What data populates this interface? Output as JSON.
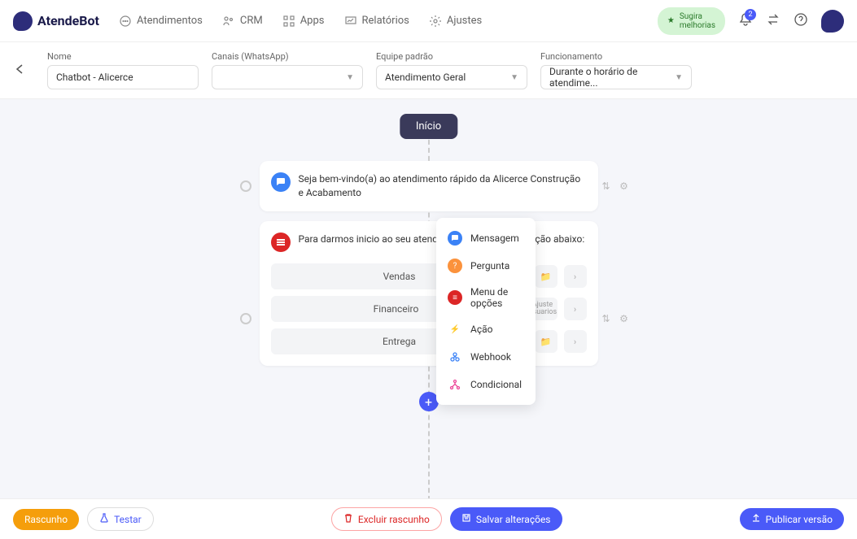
{
  "brand": "AtendeBot",
  "nav": {
    "atendimentos": "Atendimentos",
    "crm": "CRM",
    "apps": "Apps",
    "relatorios": "Relatórios",
    "ajustes": "Ajustes"
  },
  "header": {
    "suggest_line1": "Sugira",
    "suggest_line2": "melhorias",
    "notif_count": "2"
  },
  "config": {
    "nome_label": "Nome",
    "nome_value": "Chatbot - Alicerce",
    "canais_label": "Canais (WhatsApp)",
    "canais_value": "",
    "equipe_label": "Equipe padrão",
    "equipe_value": "Atendimento Geral",
    "func_label": "Funcionamento",
    "func_value": "Durante o horário de atendime..."
  },
  "flow": {
    "start": "Início",
    "msg1": "Seja bem-vindo(a) ao atendimento rápido da Alicerce Construção e Acabamento",
    "msg2": "Para darmos inicio ao seu atendimento, selecione a opção abaixo:",
    "options": [
      "Vendas",
      "Financeiro",
      "Entrega"
    ],
    "opt_tip1": "Ajuste",
    "opt_tip2": "Usuarios"
  },
  "popover": {
    "mensagem": "Mensagem",
    "pergunta": "Pergunta",
    "menu": "Menu de opções",
    "acao": "Ação",
    "webhook": "Webhook",
    "condicional": "Condicional"
  },
  "footer": {
    "rascunho": "Rascunho",
    "testar": "Testar",
    "excluir": "Excluir rascunho",
    "salvar": "Salvar alterações",
    "publicar": "Publicar versão"
  }
}
